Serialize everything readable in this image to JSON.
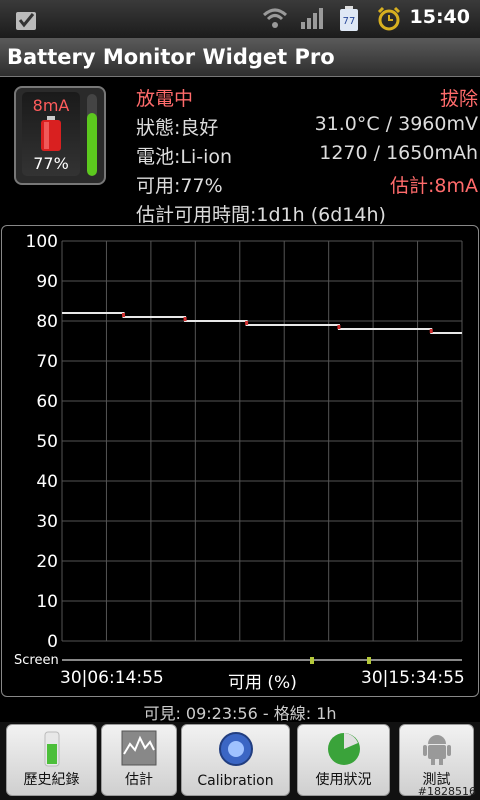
{
  "status_bar": {
    "time": "15:40",
    "battery_icon_text": "77",
    "icons": [
      "checkmark-notification-icon",
      "wifi-icon",
      "signal-icon",
      "battery-icon",
      "alarm-icon"
    ]
  },
  "app": {
    "title": "Battery Monitor Widget Pro"
  },
  "battery_tile": {
    "current": "8mA",
    "percent": "77%",
    "level_fraction": 0.77
  },
  "info": {
    "state": "放電中",
    "plug": "拔除",
    "health": "狀態:良好",
    "temp_voltage": "31.0°C / 3960mV",
    "battery_type": "電池:Li-ion",
    "capacity": "1270 / 1650mAh",
    "available": "可用:77%",
    "estimate": "估計:8mA",
    "remaining_time": "估計可用時間:1d1h (6d14h)"
  },
  "chart_data": {
    "type": "line",
    "ylim": [
      0,
      100
    ],
    "y_ticks": [
      "100",
      "90",
      "80",
      "70",
      "60",
      "50",
      "40",
      "30",
      "20",
      "10",
      "0"
    ],
    "series": [
      {
        "values": [
          82,
          82,
          81,
          81,
          80,
          80,
          79,
          79,
          79,
          78,
          78,
          78,
          77,
          77
        ]
      }
    ],
    "screen_row_label": "Screen",
    "x_start_label": "30|06:14:55",
    "x_center_label": "可用 (%)",
    "x_end_label": "30|15:34:55"
  },
  "footer": {
    "visible_span": "可見: 09:23:56 - 格線: 1h"
  },
  "buttons": [
    {
      "label": "歷史紀錄",
      "icon": "history-icon"
    },
    {
      "label": "估計",
      "icon": "estimate-chart-icon"
    },
    {
      "label": "Calibration",
      "icon": "calibration-icon"
    },
    {
      "label": "使用狀況",
      "icon": "usage-pie-icon"
    },
    {
      "label": "測試",
      "icon": "android-robot-icon"
    }
  ],
  "watermark": "#1828516",
  "colors": {
    "accent_red": "#ff6b6b",
    "battery_green": "#5cc81e"
  }
}
